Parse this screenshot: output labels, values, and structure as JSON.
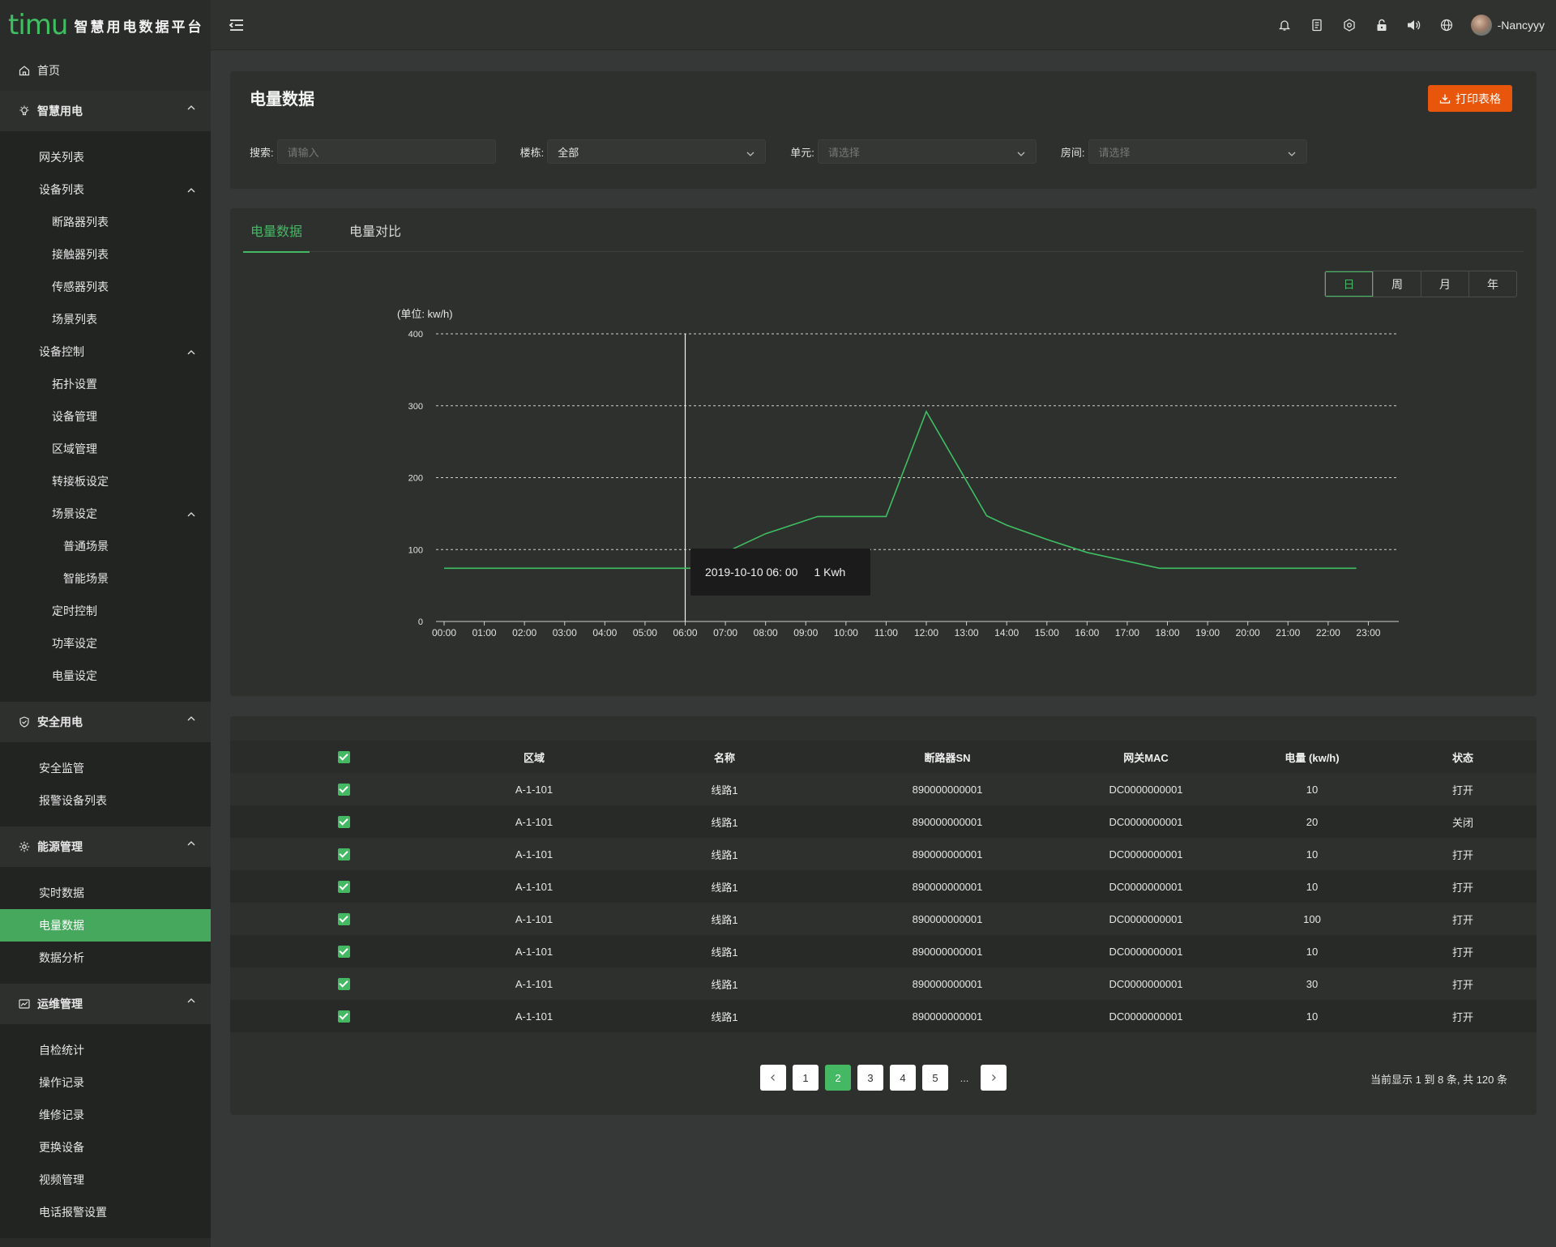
{
  "app": {
    "logo_text": "timu",
    "title": "智慧用电数据平台",
    "username": "-Nancyyy"
  },
  "topbar": {
    "icons": [
      "bell-icon",
      "document-icon",
      "settings-icon",
      "lock-icon",
      "volume-icon",
      "globe-icon"
    ]
  },
  "sidebar": {
    "home": "首页",
    "smart": {
      "label": "智慧用电",
      "gateway_list": "网关列表",
      "device_list": "设备列表",
      "device_items": [
        "断路器列表",
        "接触器列表",
        "传感器列表",
        "场景列表"
      ],
      "device_control": "设备控制",
      "control_items": [
        "拓扑设置",
        "设备管理",
        "区域管理",
        "转接板设定"
      ],
      "scene_setting": "场景设定",
      "scene_items": [
        "普通场景",
        "智能场景"
      ],
      "control_items_2": [
        "定时控制",
        "功率设定",
        "电量设定"
      ]
    },
    "safety": {
      "label": "安全用电",
      "items": [
        "安全监管",
        "报警设备列表"
      ]
    },
    "energy": {
      "label": "能源管理",
      "items": [
        "实时数据",
        "电量数据",
        "数据分析"
      ]
    },
    "ops": {
      "label": "运维管理",
      "items": [
        "自检统计",
        "操作记录",
        "维修记录",
        "更换设备",
        "视频管理",
        "电话报警设置"
      ]
    }
  },
  "filter": {
    "page_title": "电量数据",
    "print_label": "打印表格",
    "search_label": "搜索:",
    "search_placeholder": "请输入",
    "building_label": "楼栋:",
    "building_value": "全部",
    "unit_label": "单元:",
    "unit_placeholder": "请选择",
    "room_label": "房间:",
    "room_placeholder": "请选择"
  },
  "chart_panel": {
    "tabs": [
      "电量数据",
      "电量对比"
    ],
    "ranges": [
      "日",
      "周",
      "月",
      "年"
    ],
    "unit_label": "(单位: kw/h)",
    "tooltip_time": "2019-10-10 06: 00",
    "tooltip_value": "1 Kwh"
  },
  "chart_data": {
    "type": "line",
    "x": [
      "00:00",
      "01:00",
      "02:00",
      "03:00",
      "04:00",
      "05:00",
      "06:00",
      "07:00",
      "08:00",
      "09:00",
      "10:00",
      "11:00",
      "12:00",
      "13:00",
      "14:00",
      "15:00",
      "16:00",
      "17:00",
      "18:00",
      "19:00",
      "20:00",
      "21:00",
      "22:00",
      "23:00"
    ],
    "points": [
      [
        0,
        74
      ],
      [
        1,
        74
      ],
      [
        2,
        74
      ],
      [
        3,
        74
      ],
      [
        4,
        74
      ],
      [
        5,
        74
      ],
      [
        6.2,
        74
      ],
      [
        7,
        96
      ],
      [
        8,
        122
      ],
      [
        9.3,
        146
      ],
      [
        10,
        146
      ],
      [
        11,
        146
      ],
      [
        12,
        292
      ],
      [
        13.5,
        147
      ],
      [
        14,
        134
      ],
      [
        15,
        114
      ],
      [
        16,
        96
      ],
      [
        17.8,
        74
      ],
      [
        19,
        74
      ],
      [
        20,
        74
      ],
      [
        21,
        74
      ],
      [
        22,
        74
      ],
      [
        22.7,
        74
      ]
    ],
    "ylim": [
      0,
      400
    ],
    "yticks": [
      0,
      100,
      200,
      300,
      400
    ],
    "line_color": "#3fbf62",
    "grid": true,
    "cursor_x": "06:00"
  },
  "table": {
    "headers": [
      "区域",
      "名称",
      "断路器SN",
      "网关MAC",
      "电量 (kw/h)",
      "状态"
    ],
    "rows": [
      [
        "A-1-101",
        "线路1",
        "890000000001",
        "DC0000000001",
        "10",
        "打开"
      ],
      [
        "A-1-101",
        "线路1",
        "890000000001",
        "DC0000000001",
        "20",
        "关闭"
      ],
      [
        "A-1-101",
        "线路1",
        "890000000001",
        "DC0000000001",
        "10",
        "打开"
      ],
      [
        "A-1-101",
        "线路1",
        "890000000001",
        "DC0000000001",
        "10",
        "打开"
      ],
      [
        "A-1-101",
        "线路1",
        "890000000001",
        "DC0000000001",
        "100",
        "打开"
      ],
      [
        "A-1-101",
        "线路1",
        "890000000001",
        "DC0000000001",
        "10",
        "打开"
      ],
      [
        "A-1-101",
        "线路1",
        "890000000001",
        "DC0000000001",
        "30",
        "打开"
      ],
      [
        "A-1-101",
        "线路1",
        "890000000001",
        "DC0000000001",
        "10",
        "打开"
      ]
    ]
  },
  "pagination": {
    "pages": [
      "1",
      "2",
      "3",
      "4",
      "5"
    ],
    "current": "2",
    "ellipsis": "...",
    "info": "当前显示 1 到 8 条, 共 120 条"
  }
}
